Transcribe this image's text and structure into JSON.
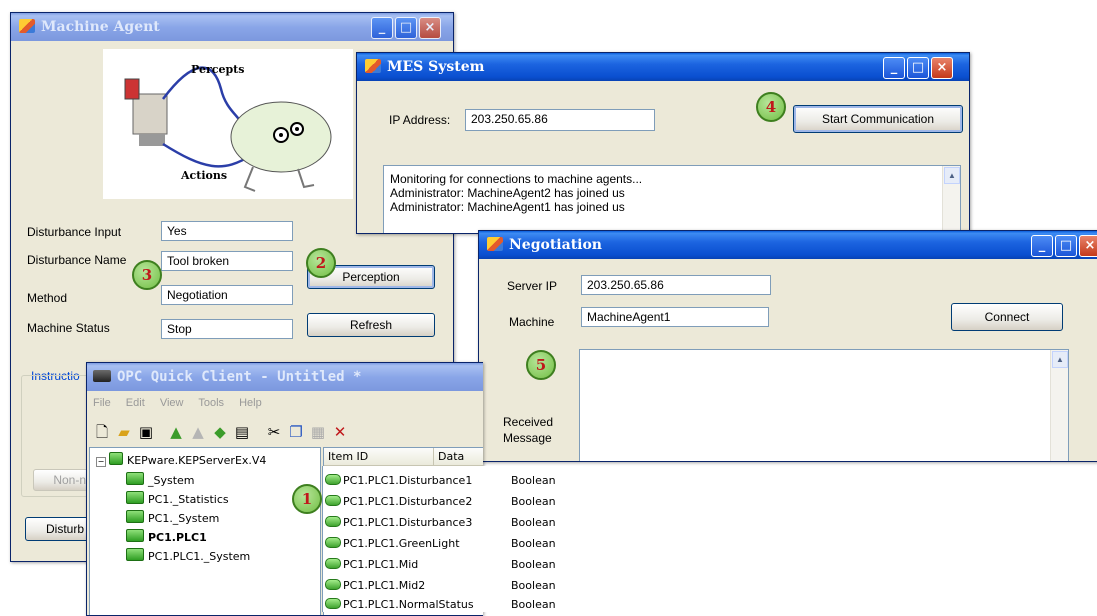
{
  "machine_agent": {
    "title": "Machine Agent",
    "diagram": {
      "percepts_label": "Percepts",
      "actions_label": "Actions"
    },
    "fields": [
      {
        "label": "Disturbance Input",
        "value": "Yes"
      },
      {
        "label": "Disturbance Name",
        "value": "Tool broken"
      },
      {
        "label": "Method",
        "value": "Negotiation"
      },
      {
        "label": "Machine Status",
        "value": "Stop"
      }
    ],
    "perception_button": "Perception",
    "refresh_button": "Refresh",
    "instruction_group": "Instructio",
    "non_button": "Non-ne",
    "disturb_button": "Disturb"
  },
  "mes_system": {
    "title": "MES System",
    "ip_label": "IP Address:",
    "ip_value": "203.250.65.86",
    "start_button": "Start Communication",
    "log": [
      "Monitoring for connections to machine agents...",
      "Administrator: MachineAgent2 has joined us",
      "Administrator: MachineAgent1 has joined us"
    ]
  },
  "negotiation": {
    "title": "Negotiation",
    "server_ip_label": "Server IP",
    "server_ip_value": "203.250.65.86",
    "machine_label": "Machine",
    "machine_value": "MachineAgent1",
    "connect_button": "Connect",
    "received_label_1": "Received",
    "received_label_2": "Message"
  },
  "opc_client": {
    "title": "OPC Quick Client - Untitled *",
    "menu": [
      "File",
      "Edit",
      "View",
      "Tools",
      "Help"
    ],
    "tree": {
      "root": "KEPware.KEPServerEx.V4",
      "children": [
        "_System",
        "PC1._Statistics",
        "PC1._System",
        "PC1.PLC1",
        "PC1.PLC1._System"
      ]
    },
    "columns": {
      "item_id": "Item ID",
      "data_type": "Data Type"
    },
    "rows": [
      {
        "id": "PC1.PLC1.Disturbance1",
        "type": "Boolean"
      },
      {
        "id": "PC1.PLC1.Disturbance2",
        "type": "Boolean"
      },
      {
        "id": "PC1.PLC1.Disturbance3",
        "type": "Boolean"
      },
      {
        "id": "PC1.PLC1.GreenLight",
        "type": "Boolean"
      },
      {
        "id": "PC1.PLC1.Mid",
        "type": "Boolean"
      },
      {
        "id": "PC1.PLC1.Mid2",
        "type": "Boolean"
      },
      {
        "id": "PC1.PLC1.NormalStatus",
        "type": "Boolean"
      }
    ]
  },
  "step_badges": [
    "1",
    "2",
    "3",
    "4",
    "5"
  ],
  "colors": {
    "titlebar": "#0a4fd0",
    "badge_fill": "#72bf44",
    "badge_text": "#c0181b",
    "window_bg": "#ece9d8"
  }
}
